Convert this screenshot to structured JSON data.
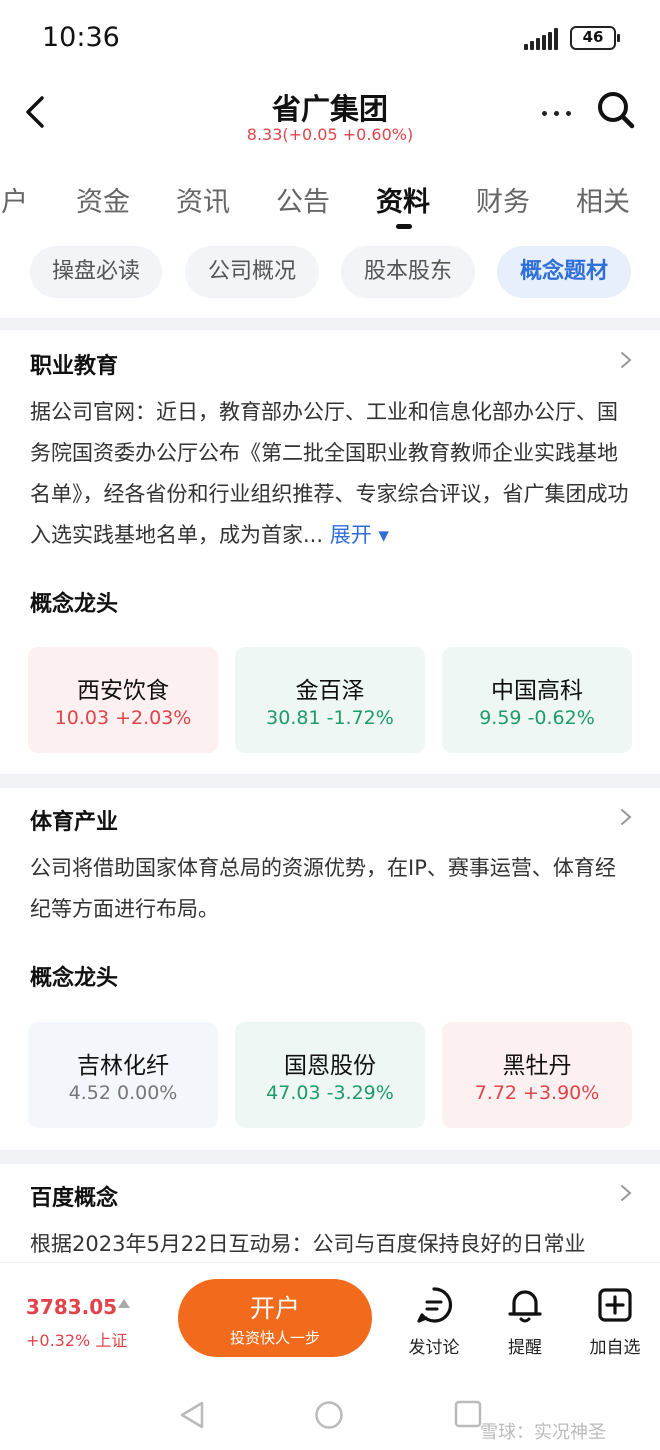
{
  "status_bar": {
    "time": "10:36",
    "battery": "46"
  },
  "header": {
    "title": "省广集团",
    "quote": "8.33(+0.05 +0.60%)",
    "price_color": "#e0444a"
  },
  "tabs": [
    {
      "label": "客户"
    },
    {
      "label": "资金"
    },
    {
      "label": "资讯"
    },
    {
      "label": "公告"
    },
    {
      "label": "资料"
    },
    {
      "label": "财务"
    },
    {
      "label": "相关"
    }
  ],
  "subtabs": [
    {
      "label": "操盘必读"
    },
    {
      "label": "公司概况"
    },
    {
      "label": "股本股东"
    },
    {
      "label": "概念题材"
    }
  ],
  "sections": [
    {
      "title": "职业教育",
      "text": "据公司官网：近日，教育部办公厅、工业和信息化部办公厅、国务院国资委办公厅公布《第二批全国职业教育教师企业实践基地名单》，经各省份和行业组织推荐、专家综合评议，省广集团成功入选实践基地名单，成为首家...",
      "expand_label": "展开 ▾",
      "leaders_title": "概念龙头",
      "leaders": [
        {
          "name": "西安饮食",
          "quote": "10.03 +2.03%"
        },
        {
          "name": "金百泽",
          "quote": "30.81 -1.72%"
        },
        {
          "name": "中国高科",
          "quote": "9.59 -0.62%"
        }
      ]
    },
    {
      "title": "体育产业",
      "text": "公司将借助国家体育总局的资源优势，在IP、赛事运营、体育经纪等方面进行布局。",
      "leaders_title": "概念龙头",
      "leaders": [
        {
          "name": "吉林化纤",
          "quote": "4.52 0.00%"
        },
        {
          "name": "国恩股份",
          "quote": "47.03 -3.29%"
        },
        {
          "name": "黑牡丹",
          "quote": "7.72 +3.90%"
        }
      ]
    },
    {
      "title": "百度概念",
      "text": "根据2023年5月22日互动易：公司与百度保持良好的日常业"
    }
  ],
  "bottom_bar": {
    "index_value": "3783.05",
    "index_change": "+0.32% 上证",
    "open_main": "开户",
    "open_sub": "投资快人一步",
    "discuss": "发讨论",
    "remind": "提醒",
    "add": "加自选"
  },
  "watermark": "雪球：实况神圣",
  "colors": {
    "up": "#e0444a",
    "down": "#1f9b6a",
    "accent": "#2f6fd8",
    "open_button": "#f26a1b"
  }
}
